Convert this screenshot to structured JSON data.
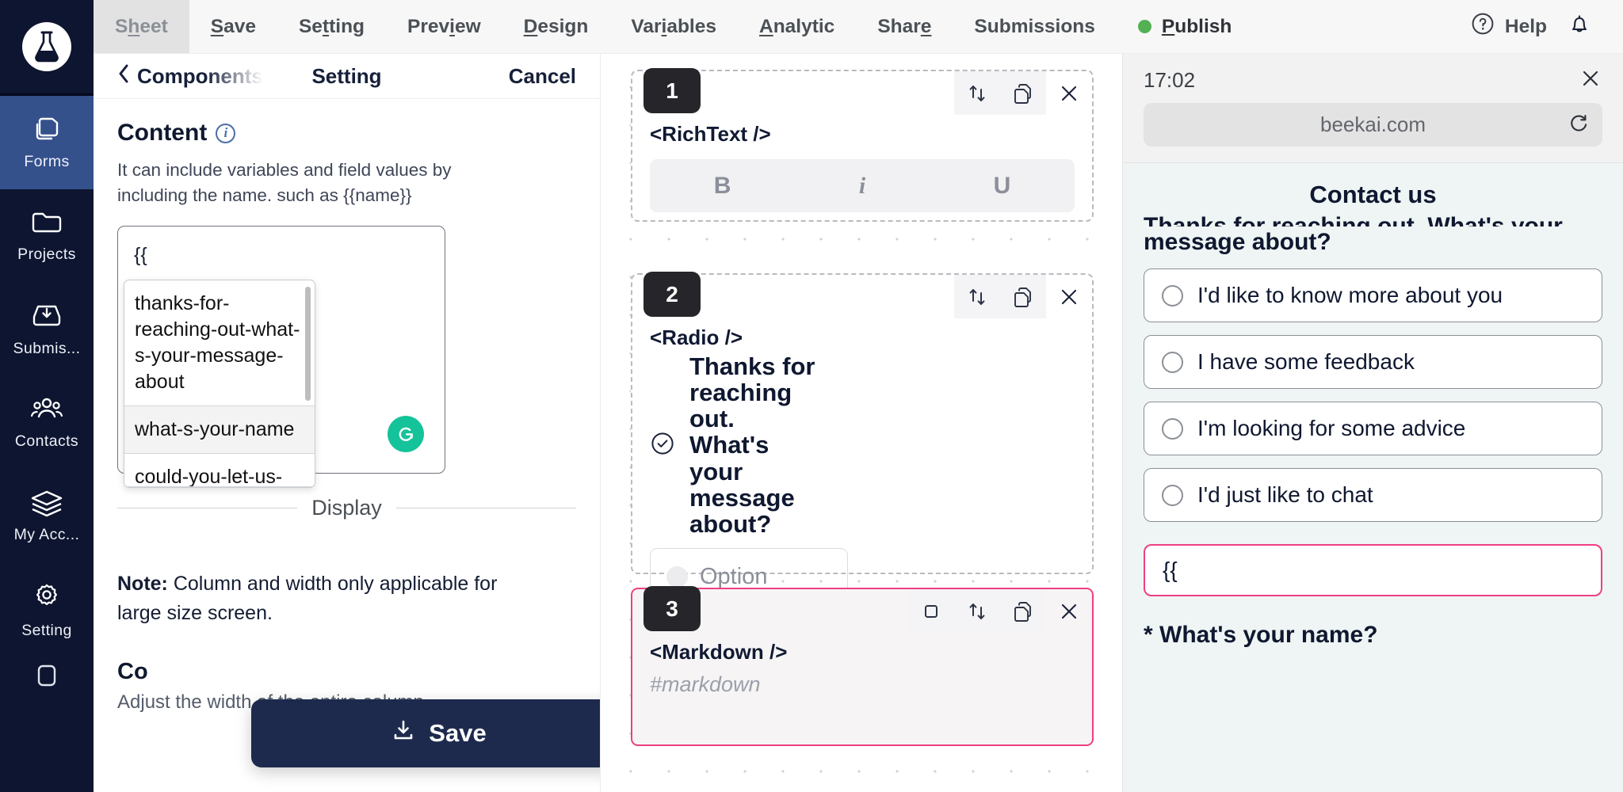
{
  "brand": {
    "logo_icon": "flask-logo-icon"
  },
  "sidebar": {
    "items": [
      {
        "label": "Forms",
        "icon": "forms-icon",
        "active": true
      },
      {
        "label": "Projects",
        "icon": "folder-icon",
        "active": false
      },
      {
        "label": "Submis...",
        "icon": "inbox-download-icon",
        "active": false
      },
      {
        "label": "Contacts",
        "icon": "people-icon",
        "active": false
      },
      {
        "label": "My Acc...",
        "icon": "layers-icon",
        "active": false
      },
      {
        "label": "Setting",
        "icon": "gear-icon",
        "active": false
      }
    ]
  },
  "topnav": {
    "items": [
      {
        "label": "Sheet",
        "accel_index": 1,
        "selected": true
      },
      {
        "label": "Save",
        "accel_index": 0,
        "selected": false
      },
      {
        "label": "Setting",
        "accel_index": 3,
        "selected": false
      },
      {
        "label": "Preview",
        "accel_index": 4,
        "selected": false
      },
      {
        "label": "Design",
        "accel_index": 0,
        "selected": false
      },
      {
        "label": "Variables",
        "accel_index": 4,
        "selected": false
      },
      {
        "label": "Analytic",
        "accel_index": 0,
        "selected": false
      },
      {
        "label": "Share",
        "accel_index": 4,
        "selected": false
      },
      {
        "label": "Submissions",
        "accel_index": -1,
        "selected": false
      }
    ],
    "publish": {
      "label": "Publish",
      "accel_index": 0,
      "status_color": "#53b153"
    },
    "help": {
      "label": "Help",
      "icon": "question-circle-icon"
    },
    "notifications_icon": "bell-icon"
  },
  "panel": {
    "back_label": "Components",
    "title": "Setting",
    "cancel_label": "Cancel",
    "content": {
      "heading": "Content",
      "info_icon": "info-icon",
      "description": "It can include variables and field values by including the name. such as {{name}}",
      "textarea_value": "{{",
      "grammarly_icon": "grammarly-icon",
      "suggestions": [
        "thanks-for-reaching-out-what-s-your-message-about",
        "what-s-your-name",
        "could-you-let-us-"
      ]
    },
    "display": {
      "divider_label": "Display",
      "note_prefix": "Note:",
      "note_text": " Column and width only applicable for large size screen.",
      "column_width_title": "Co",
      "column_width_desc": "Adjust the width of the entire column."
    },
    "save_button": {
      "label": "Save",
      "icon": "download-icon"
    }
  },
  "canvas": {
    "blocks": [
      {
        "number": "1",
        "tag": "<RichText />",
        "selected": false,
        "tools": [
          "move-updown-icon",
          "duplicate-icon",
          "delete-icon"
        ],
        "format_buttons": [
          "B",
          "i",
          "U"
        ]
      },
      {
        "number": "2",
        "tag": "<Radio />",
        "selected": false,
        "tools": [
          "move-updown-icon",
          "duplicate-icon",
          "delete-icon"
        ],
        "title": "Thanks for reaching out. What's your message about?",
        "check_icon": "check-circle-icon",
        "option_placeholder": "Option"
      },
      {
        "number": "3",
        "tag": "<Markdown />",
        "selected": true,
        "tools": [
          "square-icon",
          "move-updown-icon",
          "duplicate-icon",
          "delete-icon"
        ],
        "sub_text": "#markdown"
      }
    ]
  },
  "preview": {
    "time": "17:02",
    "close_icon": "close-icon",
    "url": "beekai.com",
    "reload_icon": "reload-icon",
    "form_title": "Contact us",
    "question_line1": "Thanks for reaching out. What's your",
    "question_line2": "message about?",
    "options": [
      "I'd like to know more about you",
      "I have some feedback",
      "I'm looking for some advice",
      "I'd just like to chat"
    ],
    "input_value": "{{",
    "input_accent": "#ef3e83",
    "next_label": "* What's your name?"
  }
}
